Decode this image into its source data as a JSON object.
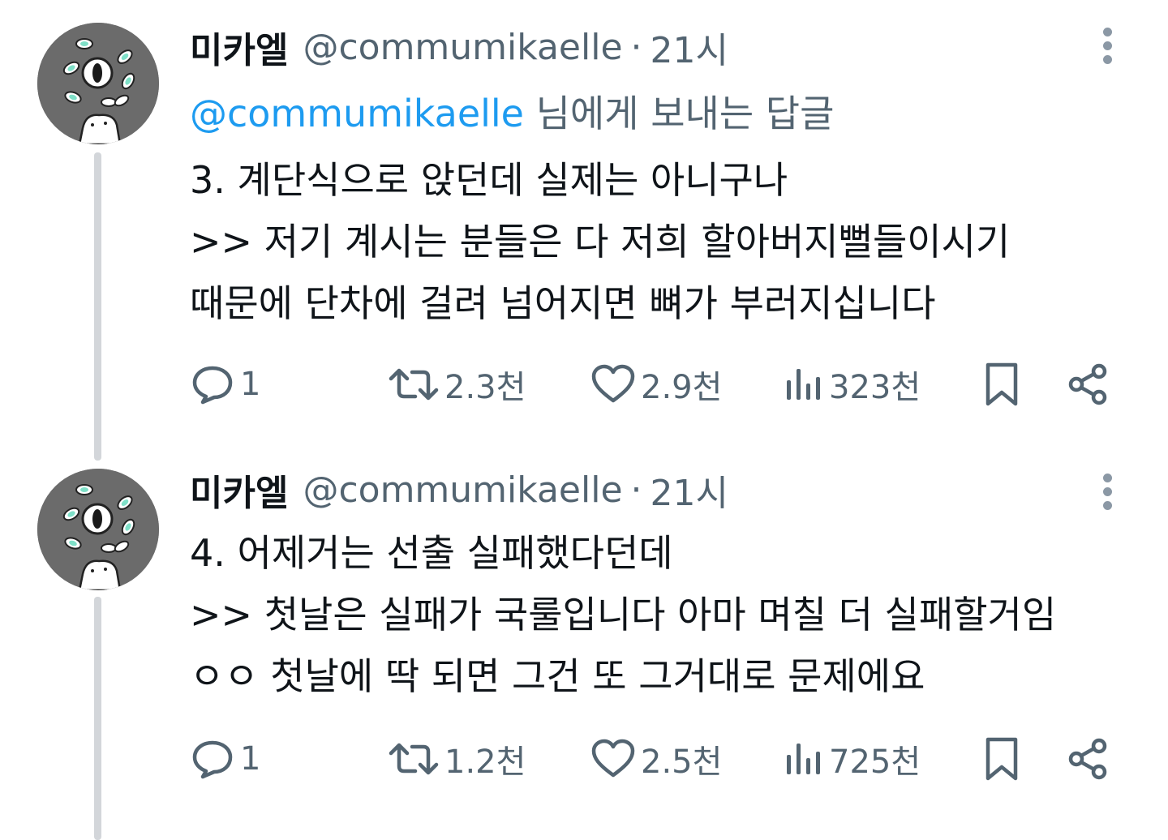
{
  "tweets": [
    {
      "author": {
        "display_name": "미카엘",
        "handle": "@commumikaelle",
        "avatar_icon": "avatar-illustration"
      },
      "separator": "·",
      "time": "21시",
      "reply_to": {
        "mention": "@commumikaelle",
        "suffix": "님에게 보내는 답글"
      },
      "body_lines": [
        "3. 계단식으로 앉던데 실제는 아니구나",
        ">> 저기 계시는 분들은 다 저희 할아버지뻘들이시기",
        "때문에 단차에 걸려 넘어지면 뼈가 부러지십니다"
      ],
      "stats": {
        "replies": "1",
        "retweets": "2.3천",
        "likes": "2.9천",
        "views": "323천"
      }
    },
    {
      "author": {
        "display_name": "미카엘",
        "handle": "@commumikaelle",
        "avatar_icon": "avatar-illustration"
      },
      "separator": "·",
      "time": "21시",
      "body_lines": [
        "4. 어제거는 선출 실패했다던데",
        ">> 첫날은 실패가 국룰입니다 아마 며칠 더 실패할거임",
        "ㅇㅇ 첫날에 딱 되면 그건 또 그거대로 문제에요"
      ],
      "stats": {
        "replies": "1",
        "retweets": "1.2천",
        "likes": "2.5천",
        "views": "725천"
      }
    }
  ],
  "colors": {
    "text_primary": "#0f1419",
    "text_secondary": "#536471",
    "link": "#1d9bf0",
    "thread_line": "#d3d6da",
    "avatar_bg": "#6b6b6b",
    "leaf_accent": "#7fe0c8"
  },
  "icons": [
    "chat-bubble-icon",
    "retweet-icon",
    "heart-icon",
    "views-bar-icon",
    "bookmark-icon",
    "share-icon",
    "more-vertical-icon"
  ]
}
